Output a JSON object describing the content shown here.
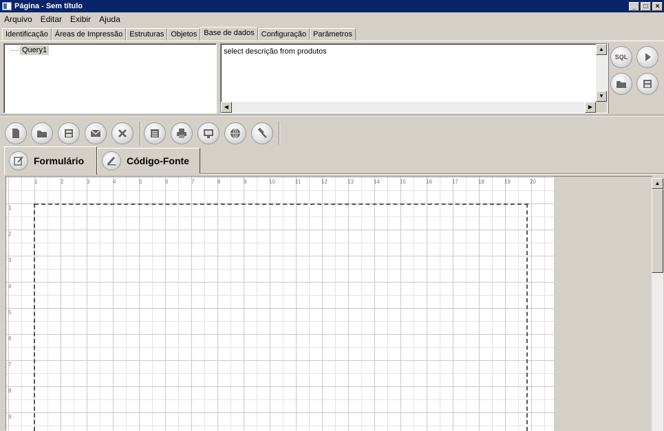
{
  "window": {
    "title": "Página - Sem título",
    "minimize": "_",
    "maximize": "□",
    "close": "×"
  },
  "menu": [
    "Arquivo",
    "Editar",
    "Exibir",
    "Ajuda"
  ],
  "top_tabs": [
    "Identificação",
    "Áreas de Impressão",
    "Estruturas",
    "Objetos",
    "Base de dados",
    "Configuração",
    "Parâmetros"
  ],
  "active_top_tab": "Base de dados",
  "tree": {
    "items": [
      "Query1"
    ]
  },
  "sql": {
    "text": "select  descrição from produtos"
  },
  "side_buttons": {
    "sql_label": "SQL"
  },
  "toolbar": {
    "buttons": [
      "new-document-icon",
      "open-folder-icon",
      "save-icon",
      "mail-icon",
      "close-icon",
      "form-icon",
      "print-icon",
      "monitor-icon",
      "globe-icon",
      "hammer-icon"
    ]
  },
  "design_tabs": [
    "Formulário",
    "Código-Fonte"
  ],
  "ruler": {
    "horizontal": [
      "1",
      "2",
      "3",
      "4",
      "5",
      "6",
      "7",
      "8",
      "9",
      "10",
      "11",
      "12",
      "13",
      "14",
      "15",
      "16",
      "17",
      "18",
      "19",
      "20"
    ],
    "vertical": [
      "1",
      "2",
      "3",
      "4",
      "5",
      "6",
      "7",
      "8",
      "9"
    ]
  }
}
